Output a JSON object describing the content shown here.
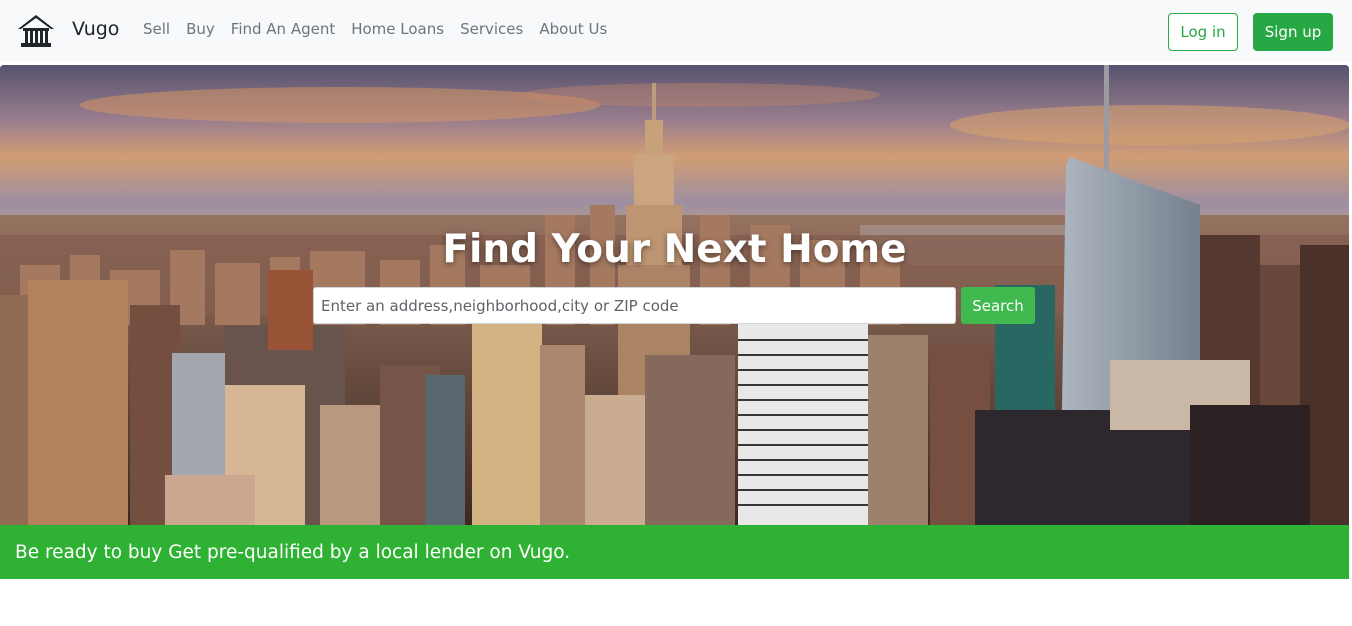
{
  "brand": {
    "name": "Vugo",
    "logo_icon": "house-icon"
  },
  "nav": {
    "items": [
      "Sell",
      "Buy",
      "Find An Agent",
      "Home Loans",
      "Services",
      "About Us"
    ]
  },
  "auth": {
    "login_label": "Log in",
    "signup_label": "Sign up"
  },
  "hero": {
    "title": "Find Your Next Home",
    "search_placeholder": "Enter an address,neighborhood,city or ZIP code",
    "search_value": "",
    "search_button_label": "Search"
  },
  "banner": {
    "text": "Be ready to buy Get pre-qualified by a local lender on Vugo."
  },
  "colors": {
    "accent": "#28a745",
    "banner": "#2fb233",
    "navbar_bg": "#f8f9fa"
  }
}
